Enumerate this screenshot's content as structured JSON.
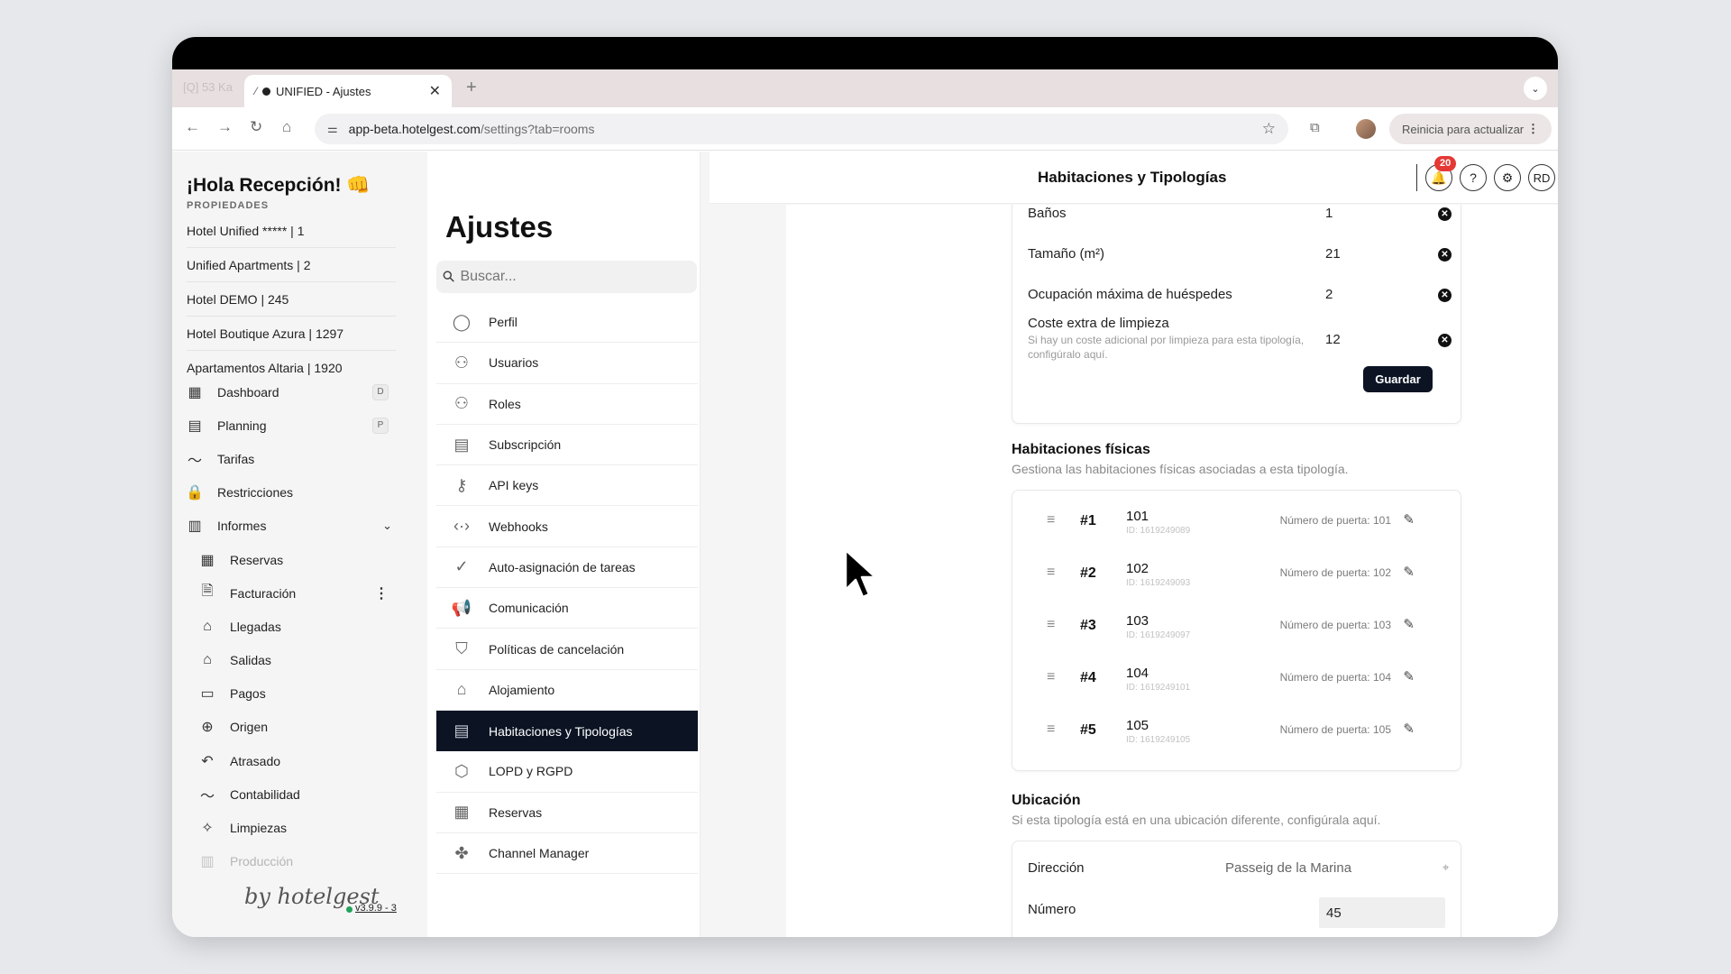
{
  "browser": {
    "ghost_tab": "[Q] 53 Ka",
    "tab_favicon": "⁄",
    "tab_title": "UNIFIED - Ajustes",
    "tab_close": "✕",
    "new_tab": "+",
    "tab_menu": "⌄",
    "url_host": "app-beta.hotelgest.com",
    "url_path": "/settings?tab=rooms",
    "update_label": "Reinicia para actualizar",
    "update_more": "⋮"
  },
  "sidebar": {
    "greeting": "¡Hola Recepción! 👊",
    "properties_label": "PROPIEDADES",
    "properties": [
      "Hotel Unified ***** | 1",
      "Unified Apartments | 2",
      "Hotel DEMO | 245",
      "Hotel Boutique Azura | 1297",
      "Apartamentos Altaria | 1920"
    ],
    "nav": [
      {
        "label": "Dashboard",
        "icon": "▦",
        "shortcut": "D"
      },
      {
        "label": "Planning",
        "icon": "▤",
        "shortcut": "P"
      },
      {
        "label": "Tarifas",
        "icon": "〜"
      },
      {
        "label": "Restricciones",
        "icon": "🔒"
      },
      {
        "label": "Informes",
        "icon": "▥",
        "chevron": "⌄"
      }
    ],
    "sub_nav": [
      {
        "label": "Reservas",
        "icon": "▦"
      },
      {
        "label": "Facturación",
        "icon": "🗎",
        "more": "⋮"
      },
      {
        "label": "Llegadas",
        "icon": "⌂"
      },
      {
        "label": "Salidas",
        "icon": "⌂"
      },
      {
        "label": "Pagos",
        "icon": "▭"
      },
      {
        "label": "Origen",
        "icon": "⊕"
      },
      {
        "label": "Atrasado",
        "icon": "↶"
      },
      {
        "label": "Contabilidad",
        "icon": "〜"
      },
      {
        "label": "Limpiezas",
        "icon": "✧"
      },
      {
        "label": "Producción",
        "icon": "▥"
      }
    ],
    "brand": "by hotelgest",
    "version": "v3.9.9 - 3"
  },
  "settings": {
    "title": "Ajustes",
    "search_placeholder": "Buscar...",
    "items": [
      {
        "label": "Perfil",
        "icon": "◯"
      },
      {
        "label": "Usuarios",
        "icon": "⚇"
      },
      {
        "label": "Roles",
        "icon": "⚇"
      },
      {
        "label": "Subscripción",
        "icon": "▤"
      },
      {
        "label": "API keys",
        "icon": "⚷"
      },
      {
        "label": "Webhooks",
        "icon": "‹·›"
      },
      {
        "label": "Auto-asignación de tareas",
        "icon": "✓"
      },
      {
        "label": "Comunicación",
        "icon": "📢"
      },
      {
        "label": "Políticas de cancelación",
        "icon": "⛉"
      },
      {
        "label": "Alojamiento",
        "icon": "⌂"
      },
      {
        "label": "Habitaciones y Tipologías",
        "icon": "▤",
        "active": true
      },
      {
        "label": "LOPD y RGPD",
        "icon": "⬡"
      },
      {
        "label": "Reservas",
        "icon": "▦"
      },
      {
        "label": "Channel Manager",
        "icon": "✤"
      }
    ]
  },
  "header": {
    "title": "Habitaciones y Tipologías",
    "notif_count": "20",
    "bell_icon": "🔔",
    "help_icon": "?",
    "settings_icon": "⚙",
    "user_initials": "RD"
  },
  "typology": {
    "fields": [
      {
        "label": "Baños",
        "value": "1"
      },
      {
        "label": "Tamaño (m²)",
        "value": "21"
      },
      {
        "label": "Ocupación máxima de huéspedes",
        "value": "2"
      },
      {
        "label": "Coste extra de limpieza",
        "value": "12",
        "help": "Si hay un coste adicional por limpieza para esta tipología, configúralo aquí."
      }
    ],
    "clear_icon": "✕",
    "save_label": "Guardar"
  },
  "rooms": {
    "title": "Habitaciones físicas",
    "subtitle": "Gestiona las habitaciones físicas asociadas a esta tipología.",
    "grip_icon": "≡",
    "edit_icon": "✎",
    "list": [
      {
        "index": "#1",
        "number": "101",
        "id": "ID: 1619249089",
        "door": "Número de puerta: 101"
      },
      {
        "index": "#2",
        "number": "102",
        "id": "ID: 1619249093",
        "door": "Número de puerta: 102"
      },
      {
        "index": "#3",
        "number": "103",
        "id": "ID: 1619249097",
        "door": "Número de puerta: 103"
      },
      {
        "index": "#4",
        "number": "104",
        "id": "ID: 1619249101",
        "door": "Número de puerta: 104"
      },
      {
        "index": "#5",
        "number": "105",
        "id": "ID: 1619249105",
        "door": "Número de puerta: 105"
      }
    ]
  },
  "location": {
    "title": "Ubicación",
    "subtitle": "Si esta tipología está en una ubicación diferente, configúrala aquí.",
    "address_label": "Dirección",
    "address_value": "Passeig de la Marina",
    "pin_icon": "⌖",
    "number_label": "Número",
    "number_value": "45"
  }
}
